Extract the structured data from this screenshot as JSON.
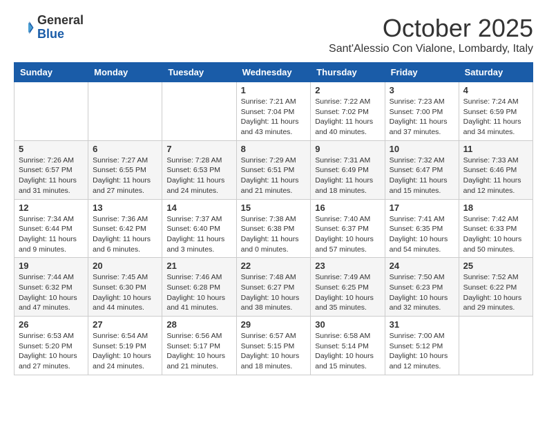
{
  "header": {
    "logo": {
      "general": "General",
      "blue": "Blue"
    },
    "title": "October 2025",
    "location": "Sant'Alessio Con Vialone, Lombardy, Italy"
  },
  "calendar": {
    "days_of_week": [
      "Sunday",
      "Monday",
      "Tuesday",
      "Wednesday",
      "Thursday",
      "Friday",
      "Saturday"
    ],
    "weeks": [
      [
        {
          "day": "",
          "info": ""
        },
        {
          "day": "",
          "info": ""
        },
        {
          "day": "",
          "info": ""
        },
        {
          "day": "1",
          "info": "Sunrise: 7:21 AM\nSunset: 7:04 PM\nDaylight: 11 hours\nand 43 minutes."
        },
        {
          "day": "2",
          "info": "Sunrise: 7:22 AM\nSunset: 7:02 PM\nDaylight: 11 hours\nand 40 minutes."
        },
        {
          "day": "3",
          "info": "Sunrise: 7:23 AM\nSunset: 7:00 PM\nDaylight: 11 hours\nand 37 minutes."
        },
        {
          "day": "4",
          "info": "Sunrise: 7:24 AM\nSunset: 6:59 PM\nDaylight: 11 hours\nand 34 minutes."
        }
      ],
      [
        {
          "day": "5",
          "info": "Sunrise: 7:26 AM\nSunset: 6:57 PM\nDaylight: 11 hours\nand 31 minutes."
        },
        {
          "day": "6",
          "info": "Sunrise: 7:27 AM\nSunset: 6:55 PM\nDaylight: 11 hours\nand 27 minutes."
        },
        {
          "day": "7",
          "info": "Sunrise: 7:28 AM\nSunset: 6:53 PM\nDaylight: 11 hours\nand 24 minutes."
        },
        {
          "day": "8",
          "info": "Sunrise: 7:29 AM\nSunset: 6:51 PM\nDaylight: 11 hours\nand 21 minutes."
        },
        {
          "day": "9",
          "info": "Sunrise: 7:31 AM\nSunset: 6:49 PM\nDaylight: 11 hours\nand 18 minutes."
        },
        {
          "day": "10",
          "info": "Sunrise: 7:32 AM\nSunset: 6:47 PM\nDaylight: 11 hours\nand 15 minutes."
        },
        {
          "day": "11",
          "info": "Sunrise: 7:33 AM\nSunset: 6:46 PM\nDaylight: 11 hours\nand 12 minutes."
        }
      ],
      [
        {
          "day": "12",
          "info": "Sunrise: 7:34 AM\nSunset: 6:44 PM\nDaylight: 11 hours\nand 9 minutes."
        },
        {
          "day": "13",
          "info": "Sunrise: 7:36 AM\nSunset: 6:42 PM\nDaylight: 11 hours\nand 6 minutes."
        },
        {
          "day": "14",
          "info": "Sunrise: 7:37 AM\nSunset: 6:40 PM\nDaylight: 11 hours\nand 3 minutes."
        },
        {
          "day": "15",
          "info": "Sunrise: 7:38 AM\nSunset: 6:38 PM\nDaylight: 11 hours\nand 0 minutes."
        },
        {
          "day": "16",
          "info": "Sunrise: 7:40 AM\nSunset: 6:37 PM\nDaylight: 10 hours\nand 57 minutes."
        },
        {
          "day": "17",
          "info": "Sunrise: 7:41 AM\nSunset: 6:35 PM\nDaylight: 10 hours\nand 54 minutes."
        },
        {
          "day": "18",
          "info": "Sunrise: 7:42 AM\nSunset: 6:33 PM\nDaylight: 10 hours\nand 50 minutes."
        }
      ],
      [
        {
          "day": "19",
          "info": "Sunrise: 7:44 AM\nSunset: 6:32 PM\nDaylight: 10 hours\nand 47 minutes."
        },
        {
          "day": "20",
          "info": "Sunrise: 7:45 AM\nSunset: 6:30 PM\nDaylight: 10 hours\nand 44 minutes."
        },
        {
          "day": "21",
          "info": "Sunrise: 7:46 AM\nSunset: 6:28 PM\nDaylight: 10 hours\nand 41 minutes."
        },
        {
          "day": "22",
          "info": "Sunrise: 7:48 AM\nSunset: 6:27 PM\nDaylight: 10 hours\nand 38 minutes."
        },
        {
          "day": "23",
          "info": "Sunrise: 7:49 AM\nSunset: 6:25 PM\nDaylight: 10 hours\nand 35 minutes."
        },
        {
          "day": "24",
          "info": "Sunrise: 7:50 AM\nSunset: 6:23 PM\nDaylight: 10 hours\nand 32 minutes."
        },
        {
          "day": "25",
          "info": "Sunrise: 7:52 AM\nSunset: 6:22 PM\nDaylight: 10 hours\nand 29 minutes."
        }
      ],
      [
        {
          "day": "26",
          "info": "Sunrise: 6:53 AM\nSunset: 5:20 PM\nDaylight: 10 hours\nand 27 minutes."
        },
        {
          "day": "27",
          "info": "Sunrise: 6:54 AM\nSunset: 5:19 PM\nDaylight: 10 hours\nand 24 minutes."
        },
        {
          "day": "28",
          "info": "Sunrise: 6:56 AM\nSunset: 5:17 PM\nDaylight: 10 hours\nand 21 minutes."
        },
        {
          "day": "29",
          "info": "Sunrise: 6:57 AM\nSunset: 5:15 PM\nDaylight: 10 hours\nand 18 minutes."
        },
        {
          "day": "30",
          "info": "Sunrise: 6:58 AM\nSunset: 5:14 PM\nDaylight: 10 hours\nand 15 minutes."
        },
        {
          "day": "31",
          "info": "Sunrise: 7:00 AM\nSunset: 5:12 PM\nDaylight: 10 hours\nand 12 minutes."
        },
        {
          "day": "",
          "info": ""
        }
      ]
    ]
  }
}
